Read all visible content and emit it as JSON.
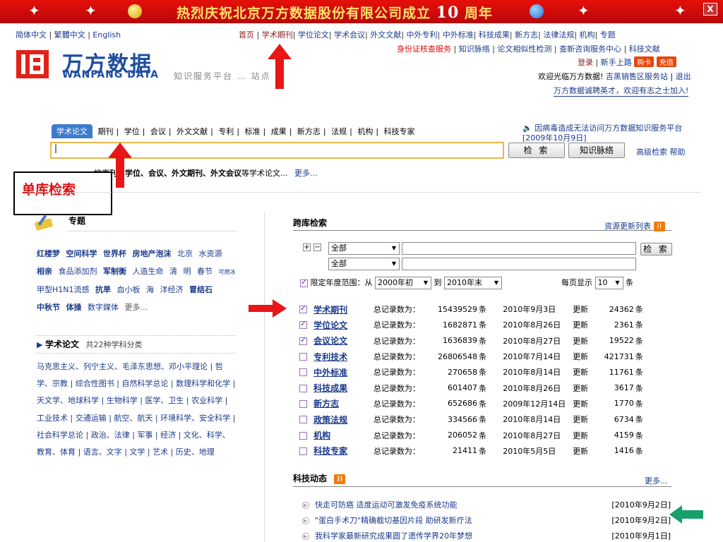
{
  "banner": {
    "title_prefix": "热烈庆祝北京万方数据股份有限公司成立",
    "title_num": "10",
    "title_suffix": "周年",
    "close": "X"
  },
  "lang": {
    "simplified": "简体中文",
    "traditional": "繁體中文",
    "english": "English"
  },
  "nav": [
    "首页",
    "学术期刊",
    "学位论文",
    "学术会议",
    "外文文献",
    "中外专利",
    "中外标准",
    "科技成果",
    "新方志",
    "法律法规",
    "机构",
    "专题"
  ],
  "nav2": [
    "身份证核查服务",
    "知识脉络",
    "论文相似性检测",
    "查新咨询服务中心",
    "科技文献"
  ],
  "login": {
    "login": "登录",
    "newbie": "新手上路",
    "buy": "购卡",
    "recharge": "充值"
  },
  "welcome": {
    "text": "欢迎光临万方数据!",
    "region": "吉黑销售区服务站",
    "logout": "退出"
  },
  "recruit": "万方数据诚聘英才，欢迎有志之士加入!",
  "logo": {
    "cn": "万方数据",
    "en": "WANFANG DATA",
    "slogan": "知识服务平台 … 站点"
  },
  "search": {
    "tabs": [
      "学术论文",
      "期刊",
      "学位",
      "会议",
      "外文文献",
      "专利",
      "标准",
      "成果",
      "新方志",
      "法规",
      "机构",
      "科技专家"
    ],
    "value": "|",
    "search_btn": "检 索",
    "knowledge_btn": "知识脉络",
    "advanced": "高级检索",
    "help": "帮助",
    "notice": "因病毒造成无法访问万方数据知识服务平台 [2009年10月9日]",
    "hint_prefix": "搜索",
    "hint_bold": "刊、学位、会议、外文期刊、外文会议",
    "hint_suffix": "等学术论文...",
    "hint_more": "更多..."
  },
  "annotation": {
    "label": "单库检索"
  },
  "topics": {
    "title": "专题",
    "items": [
      {
        "t": "红楼梦",
        "s": "b"
      },
      {
        "t": "空间科学",
        "s": "b"
      },
      {
        "t": "世界杯",
        "s": "b"
      },
      {
        "t": "房地产泡沫",
        "s": "b"
      },
      {
        "t": "北京",
        "s": "n"
      },
      {
        "t": "水资源",
        "s": "n"
      },
      {
        "t": "相亲",
        "s": "b"
      },
      {
        "t": "食品添加剂",
        "s": "n"
      },
      {
        "t": "军制衡",
        "s": "b"
      },
      {
        "t": "人造生命",
        "s": "n"
      },
      {
        "t": "清",
        "s": "n"
      },
      {
        "t": "明",
        "s": "n"
      },
      {
        "t": "春节",
        "s": "n"
      },
      {
        "t": "可燃冰",
        "s": "s"
      },
      {
        "t": "甲型H1N1流感",
        "s": "n"
      },
      {
        "t": "抗旱",
        "s": "b"
      },
      {
        "t": "血小板",
        "s": "n"
      },
      {
        "t": "海",
        "s": "n"
      },
      {
        "t": "洋经济",
        "s": "n"
      },
      {
        "t": "冒结石",
        "s": "b"
      },
      {
        "t": "中秋节",
        "s": "b"
      },
      {
        "t": "体操",
        "s": "b"
      },
      {
        "t": "数字媒体",
        "s": "n"
      },
      {
        "t": "更多...",
        "s": "more"
      }
    ]
  },
  "papers": {
    "title": "学术论文",
    "count": "共22种学科分类",
    "disciplines": "马克思主义、列宁主义、毛泽东思想、邓小平理论 | 哲学、宗教 | 综合性图书 | 自然科学总论 | 数理科学和化学 | 天文学、地球科学 | 生物科学 | 医学、卫生 | 农业科学 | 工业技术 | 交通运输 | 航空、航天 | 环境科学、安全科学 | 社会科学总论 | 政治、法律 | 军事 | 经济 | 文化、科学、教育、体育 | 语言、文字 | 文学 | 艺术 | 历史、地理"
  },
  "cross": {
    "title": "跨库检索",
    "update_list": "资源更新列表",
    "field1": "全部",
    "field2": "全部",
    "search_btn": "检 索",
    "range_label": "限定年度范围：从",
    "from": "2000年初",
    "to_label": "到",
    "to": "2010年末",
    "per_page_label": "每页显示",
    "per_page": "10",
    "per_page_unit": "条"
  },
  "databases": [
    {
      "name": "学术期刊",
      "checked": true,
      "label": "总记录数为：",
      "total": "15439529",
      "date": "2010年9月3日",
      "upd": "更新",
      "new": "24362"
    },
    {
      "name": "学位论文",
      "checked": true,
      "label": "总记录数为：",
      "total": "1682871",
      "date": "2010年8月26日",
      "upd": "更新",
      "new": "2361"
    },
    {
      "name": "会议论文",
      "checked": true,
      "label": "总记录数为：",
      "total": "1636839",
      "date": "2010年8月27日",
      "upd": "更新",
      "new": "19522"
    },
    {
      "name": "专利技术",
      "checked": false,
      "label": "总记录数为：",
      "total": "26806548",
      "date": "2010年7月14日",
      "upd": "更新",
      "new": "421731"
    },
    {
      "name": "中外标准",
      "checked": false,
      "label": "总记录数为：",
      "total": "270658",
      "date": "2010年8月14日",
      "upd": "更新",
      "new": "11761"
    },
    {
      "name": "科技成果",
      "checked": false,
      "label": "总记录数为：",
      "total": "601407",
      "date": "2010年8月26日",
      "upd": "更新",
      "new": "3617"
    },
    {
      "name": "新方志",
      "checked": false,
      "label": "总记录数为：",
      "total": "652686",
      "date": "2009年12月14日",
      "upd": "更新",
      "new": "1770"
    },
    {
      "name": "政策法规",
      "checked": false,
      "label": "总记录数为：",
      "total": "334566",
      "date": "2010年8月14日",
      "upd": "更新",
      "new": "6734"
    },
    {
      "name": "机构",
      "checked": false,
      "label": "总记录数为：",
      "total": "206052",
      "date": "2010年8月27日",
      "upd": "更新",
      "new": "4159"
    },
    {
      "name": "科技专家",
      "checked": false,
      "label": "总记录数为：",
      "total": "21411",
      "date": "2010年5月5日",
      "upd": "更新",
      "new": "1416"
    }
  ],
  "unit": "条",
  "news": {
    "title": "科技动态",
    "more": "更多...",
    "items": [
      {
        "t": "快走可防癌 适度运动可激发免疫系统功能",
        "d": "[2010年9月2日]"
      },
      {
        "t": "\"蛋白手术刀\"精确截切基因片段 助研发新疗法",
        "d": "[2010年9月2日]"
      },
      {
        "t": "我科学家最新研究成果圆了遗传学界20年梦想",
        "d": "[2010年9月1日]"
      }
    ]
  }
}
